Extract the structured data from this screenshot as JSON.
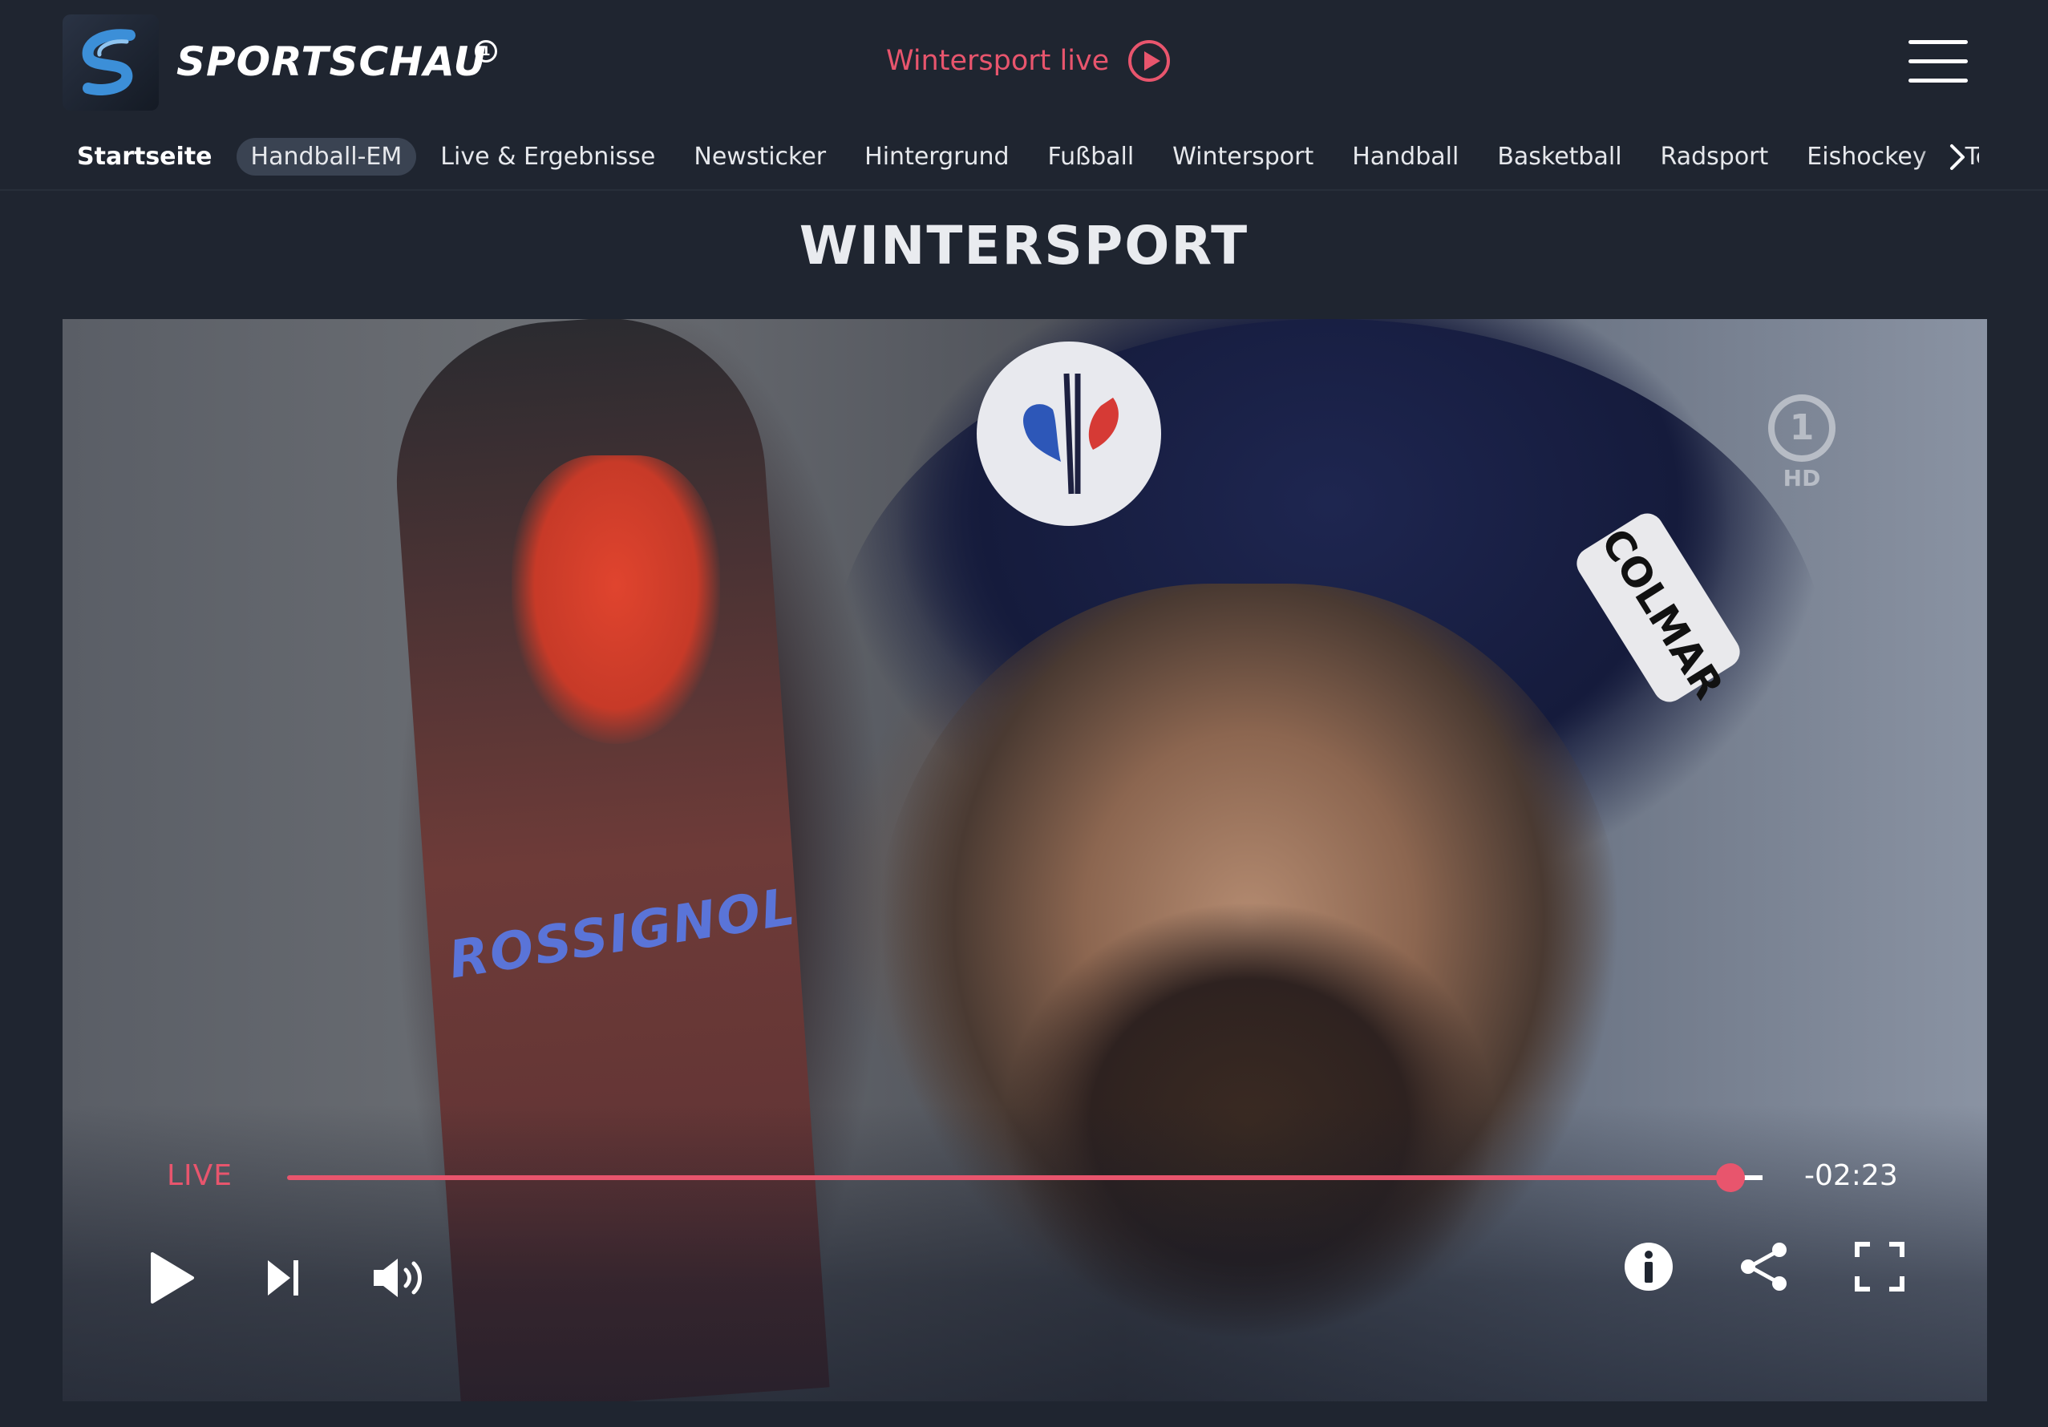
{
  "header": {
    "brand": "SPORTSCHAU",
    "brand_mark": "1",
    "live_link": "Wintersport live"
  },
  "nav": {
    "items": [
      {
        "label": "Startseite"
      },
      {
        "label": "Handball-EM"
      },
      {
        "label": "Live & Ergebnisse"
      },
      {
        "label": "Newsticker"
      },
      {
        "label": "Hintergrund"
      },
      {
        "label": "Fußball"
      },
      {
        "label": "Wintersport"
      },
      {
        "label": "Handball"
      },
      {
        "label": "Basketball"
      },
      {
        "label": "Radsport"
      },
      {
        "label": "Eishockey"
      },
      {
        "label": "Tennis"
      }
    ]
  },
  "page": {
    "title": "WINTERSPORT"
  },
  "video": {
    "ski_brand": "ROSSIGNOL",
    "hat_brand": "COLMAR",
    "channel_logo": "1",
    "channel_quality": "HD",
    "live_label": "LIVE",
    "time_remaining": "-02:23",
    "progress": 0.985
  },
  "icons": {
    "menu": "hamburger-menu-icon",
    "live_play": "play-circle-icon",
    "nav_next": "chevron-right-icon",
    "play": "play-icon",
    "next": "skip-next-icon",
    "volume": "volume-icon",
    "info": "info-icon",
    "share": "share-icon",
    "fullscreen": "fullscreen-icon"
  },
  "colors": {
    "accent": "#e8556d",
    "background": "#1f2530",
    "pill": "#3a4352"
  }
}
